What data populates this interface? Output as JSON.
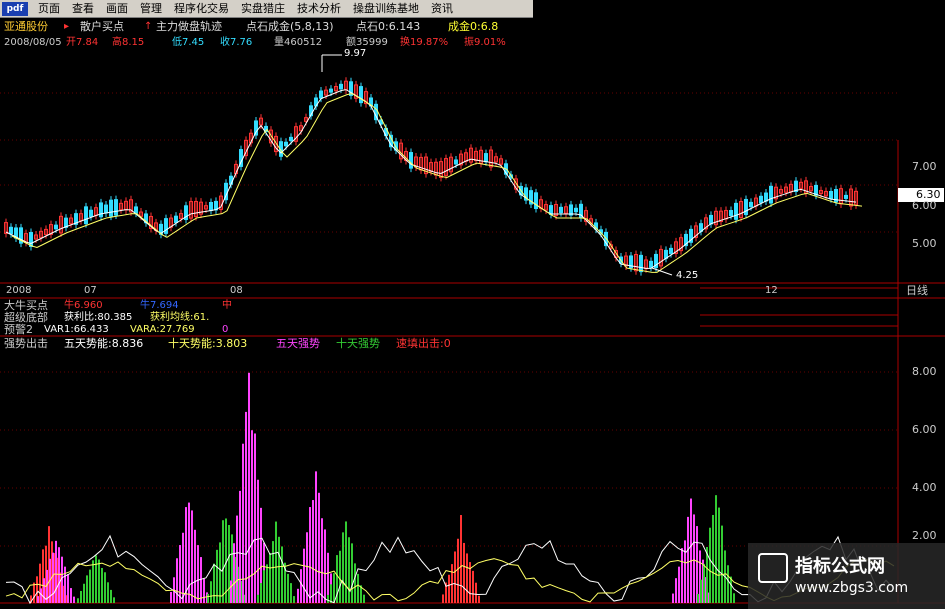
{
  "menu": {
    "logo": "pdf",
    "items": [
      "页面",
      "查看",
      "画面",
      "管理",
      "程序化交易",
      "实盘猎庄",
      "技术分析",
      "操盘训练基地",
      "资讯"
    ]
  },
  "header": {
    "stock_name": "亚通股份",
    "ind_1": "散户买点",
    "ind_2": "主力做盘轨迹",
    "ind_3": "点石成金(5,8,13)",
    "ind_4": "点石0:6.143",
    "ind_5": "成金0:6.8"
  },
  "quote": {
    "date": "2008/08/05",
    "open": "开7.84",
    "high": "高8.15",
    "low": "低7.45",
    "close": "收7.76",
    "volume": "量460512",
    "amount": "额35999",
    "turnover": "换19.87%",
    "amplitude": "振9.01%"
  },
  "price_axis": [
    "7.00",
    "6.00",
    "5.00"
  ],
  "current_price": "6.30",
  "annotations": {
    "high_mark": "9.97",
    "low_mark": "4.25"
  },
  "time_axis": {
    "year": "2008",
    "m1": "07",
    "m2": "08",
    "m3": "12",
    "period": "日线"
  },
  "sub_panels": {
    "p1_title": "大牛买点",
    "p1_v1": "牛6.960",
    "p1_v2": "牛7.694",
    "p1_v3": "中",
    "p2_title": "超级底部",
    "p2_v1": "获利比:80.385",
    "p2_v2": "获利均线:61.",
    "p3_title": "预警2",
    "p3_v1": "VAR1:66.433",
    "p3_v2": "VARA:27.769",
    "p3_v3": "0"
  },
  "strength_panel": {
    "title": "强势出击",
    "five_day": "五天势能:8.836",
    "ten_day": "十天势能:3.803",
    "five_strong": "五天强势",
    "ten_strong": "十天强势",
    "sell": "速填出击:0",
    "axis": [
      "8.00",
      "6.00",
      "4.00",
      "2.00"
    ]
  },
  "watermark": {
    "line1": "指标公式网",
    "line2": "www.zbgs3.com"
  },
  "colors": {
    "up": "#ff3333",
    "down": "#33ddff",
    "ma_white": "#ffffff",
    "ma_yellow": "#ffff66",
    "magenta": "#ff44ff",
    "green": "#33cc33"
  }
}
